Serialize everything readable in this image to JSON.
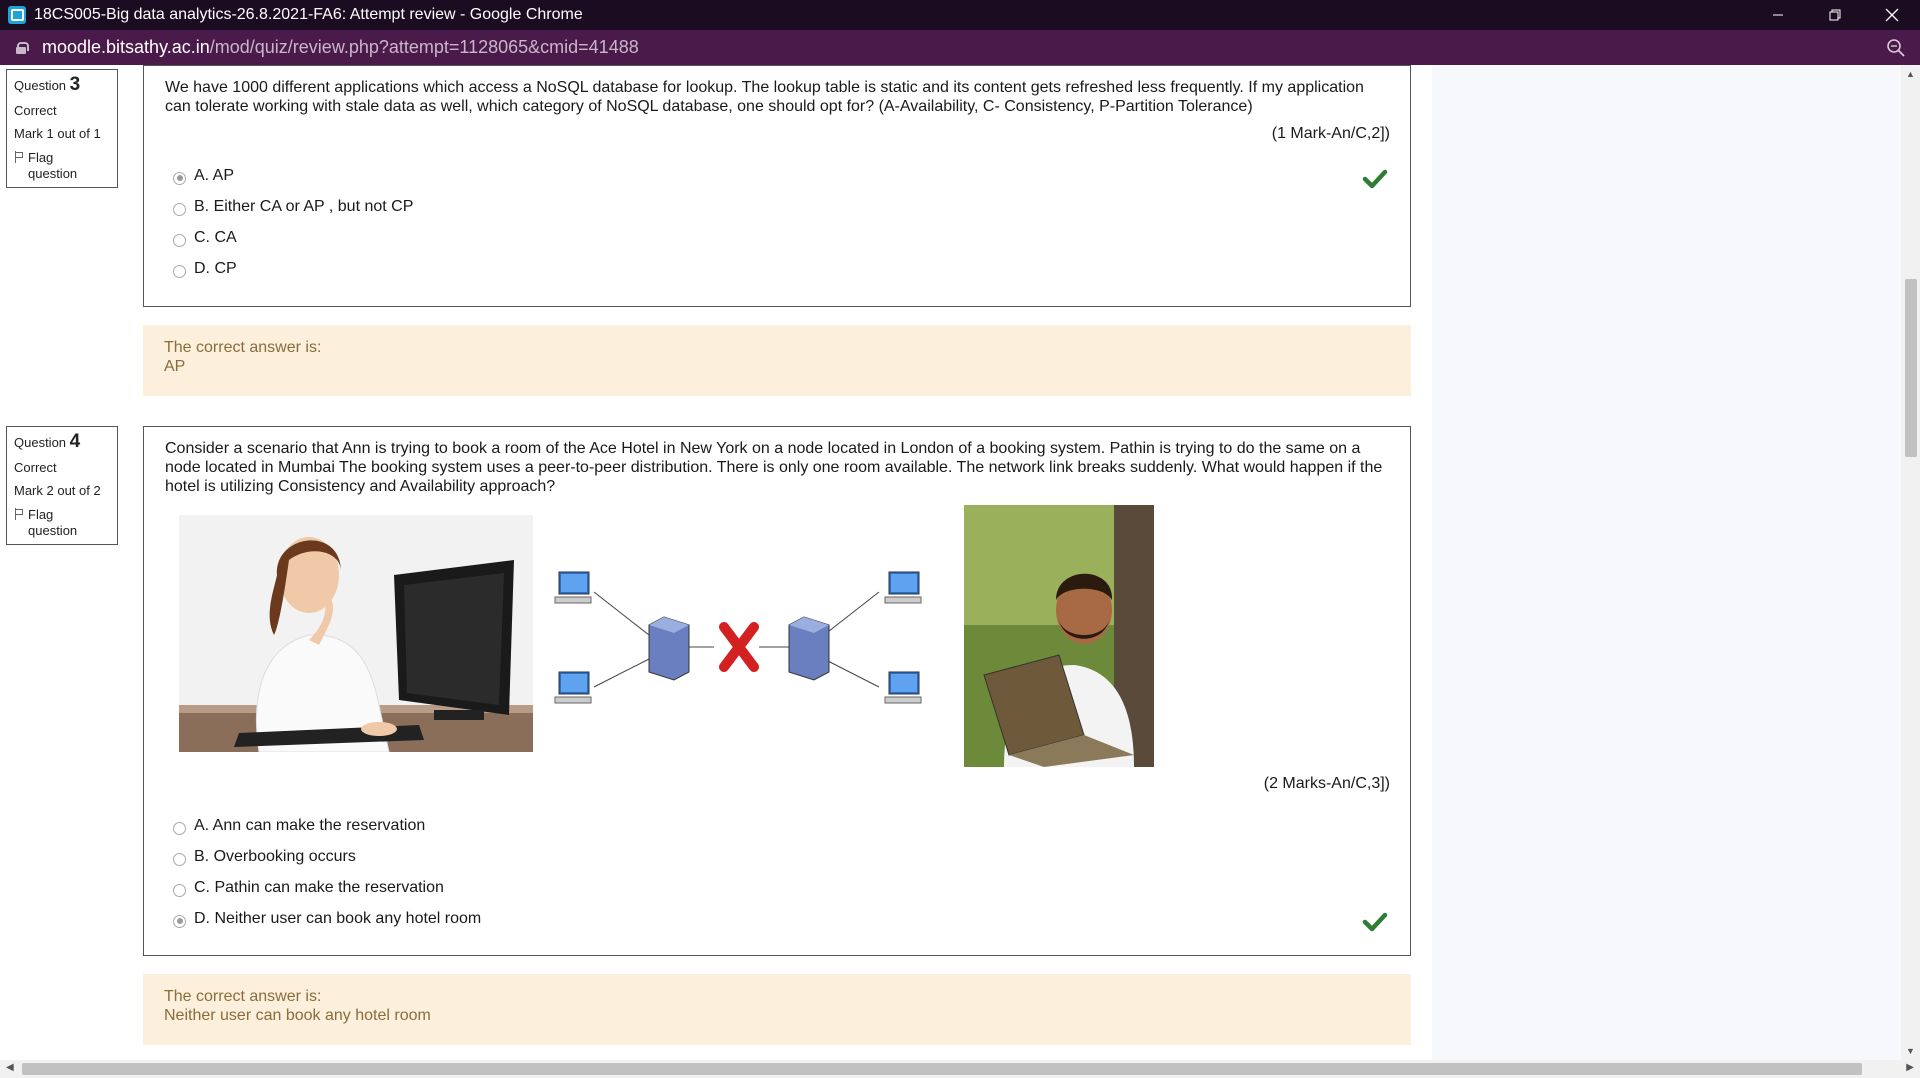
{
  "window": {
    "title": "18CS005-Big data analytics-26.8.2021-FA6: Attempt review - Google Chrome",
    "url_host": "moodle.bitsathy.ac.in",
    "url_path": "/mod/quiz/review.php?attempt=1128065&cmid=41488"
  },
  "questions": [
    {
      "label": "Question",
      "number": "3",
      "state": "Correct",
      "grade": "Mark 1 out of 1",
      "flag_label": "Flag question",
      "text": "We have 1000 different applications which access a NoSQL database for lookup. The lookup table is static and its content gets refreshed less frequently. If my application can tolerate working with stale data as well, which category of NoSQL database, one should opt for? (A-Availability, C- Consistency, P-Partition Tolerance)",
      "marks": "(1 Mark-An/C,2])",
      "options": [
        {
          "label": "A. AP",
          "checked": true
        },
        {
          "label": "B. Either CA or AP , but not CP",
          "checked": false
        },
        {
          "label": "C. CA",
          "checked": false
        },
        {
          "label": "D. CP",
          "checked": false
        }
      ],
      "feedback_title": "The correct answer is:",
      "feedback_answer": "AP"
    },
    {
      "label": "Question",
      "number": "4",
      "state": "Correct",
      "grade": "Mark 2 out of 2",
      "flag_label": "Flag question",
      "text": "Consider a scenario that Ann is trying to book a room of the Ace Hotel in New York on a node located in London of a booking system. Pathin is trying to do the same on a node located in Mumbai The booking system uses a peer-to-peer distribution. There is only one room available. The network link breaks suddenly. What would happen if the hotel is utilizing Consistency and Availability approach?",
      "marks": "(2 Marks-An/C,3])",
      "options": [
        {
          "label": "A. Ann can make the reservation",
          "checked": false
        },
        {
          "label": "B. Overbooking occurs",
          "checked": false
        },
        {
          "label": "C. Pathin can make the reservation",
          "checked": false
        },
        {
          "label": "D. Neither user can book any hotel room",
          "checked": true
        }
      ],
      "feedback_title": "The correct answer is:",
      "feedback_answer": "Neither user can book any hotel room"
    }
  ],
  "colors": {
    "titlebar": "#1b0c21",
    "addressbar": "#4a1a4a",
    "feedback_bg": "#fcefdc",
    "feedback_text": "#8a6d3b",
    "check": "#2e7d32"
  },
  "icons": [
    "app-icon",
    "minimize-icon",
    "restore-icon",
    "close-icon",
    "lock-icon",
    "zoom-icon",
    "flag-icon",
    "check-icon",
    "radio-icon"
  ]
}
